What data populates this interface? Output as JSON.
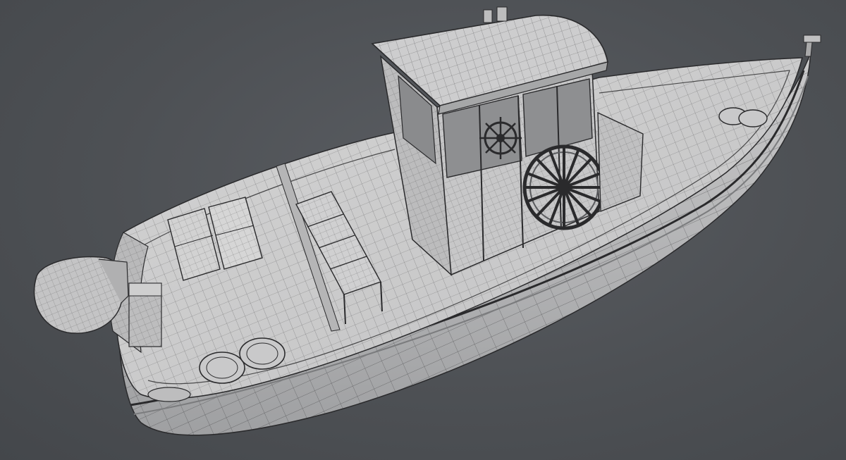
{
  "scene": {
    "subject": "boat-wireframe-model",
    "colors": {
      "background": "#4f5256",
      "surface": "#cfcfcf",
      "surface_shadow": "#a9a9aa",
      "surface_dark": "#8d8e90",
      "wire": "#2a2a2c"
    }
  }
}
